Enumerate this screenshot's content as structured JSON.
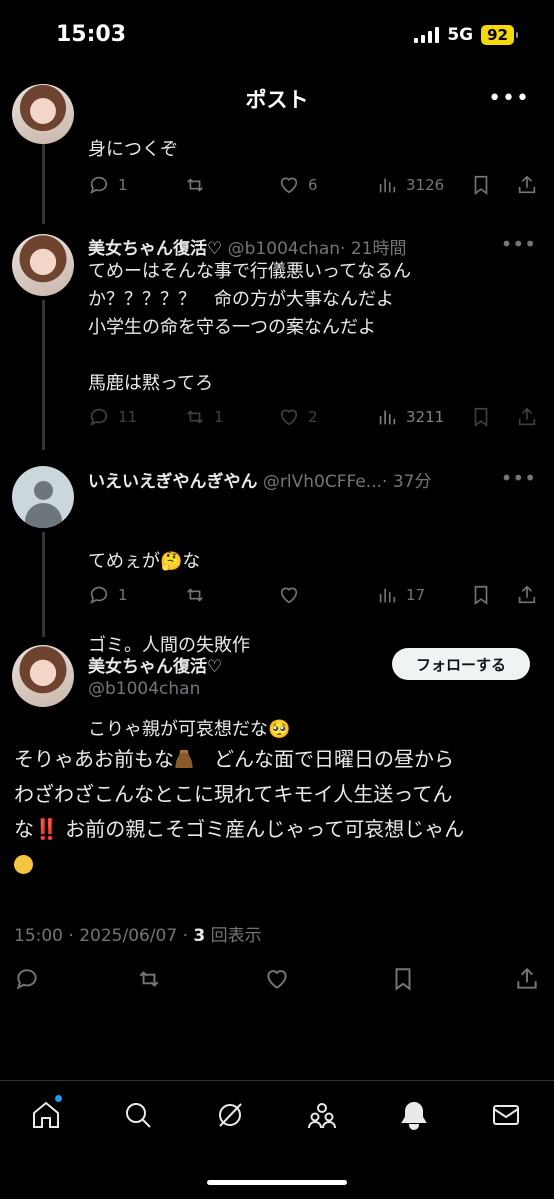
{
  "status_bar": {
    "time": "15:03",
    "network": "5G",
    "battery": "92"
  },
  "header": {
    "title": "ポスト",
    "back_icon": "arrow-left-icon",
    "more_icon": "more-icon"
  },
  "tweets": [
    {
      "body": "身につくぞ",
      "counts": {
        "reply": "1",
        "retweet": "",
        "like": "6",
        "views": "3126"
      }
    },
    {
      "name": "美女ちゃん復活♡",
      "handle": "@b1004chan",
      "time": "· 21時間",
      "body": "てめーはそんな事で行儀悪いってなるん\nか？？？？？　命の方が大事なんだよ\n小学生の命を守る一つの案なんだよ\n\n馬鹿は黙ってろ",
      "counts": {
        "reply": "11",
        "retweet": "1",
        "like": "2",
        "views": "3211"
      }
    },
    {
      "name": "いえいえぎやんぎやん",
      "handle": "@rlVh0CFFe...",
      "time": "· 37分",
      "body_lines": [
        "てめぇが🤔な",
        "ゴミ。人間の失敗作",
        "こりゃ親が可哀想だな🥺"
      ],
      "counts": {
        "reply": "1",
        "retweet": "",
        "like": "",
        "views": "17"
      }
    }
  ],
  "main_post": {
    "name": "美女ちゃん復活♡",
    "handle": "@b1004chan",
    "follow_label": "フォローする",
    "text_1": "そりゃあお前もな",
    "text_2": "　どんな面で日曜日の昼から",
    "text_3": "わざわざこんなとこに現れてキモイ人生送ってん",
    "text_4": "な",
    "text_5": "‼️",
    "text_6": " お前の親こそゴミ産んじゃって可哀想じゃん",
    "meta_time": "15:00 · 2025/06/07 · ",
    "meta_views": "3",
    "meta_views_label": " 回表示"
  },
  "tab_bar": [
    "home-icon",
    "search-icon",
    "grok-icon",
    "communities-icon",
    "notifications-icon",
    "messages-icon"
  ],
  "colors": {
    "background": "#000000",
    "secondary_text": "#71767b",
    "accent": "#1d9bf0"
  }
}
